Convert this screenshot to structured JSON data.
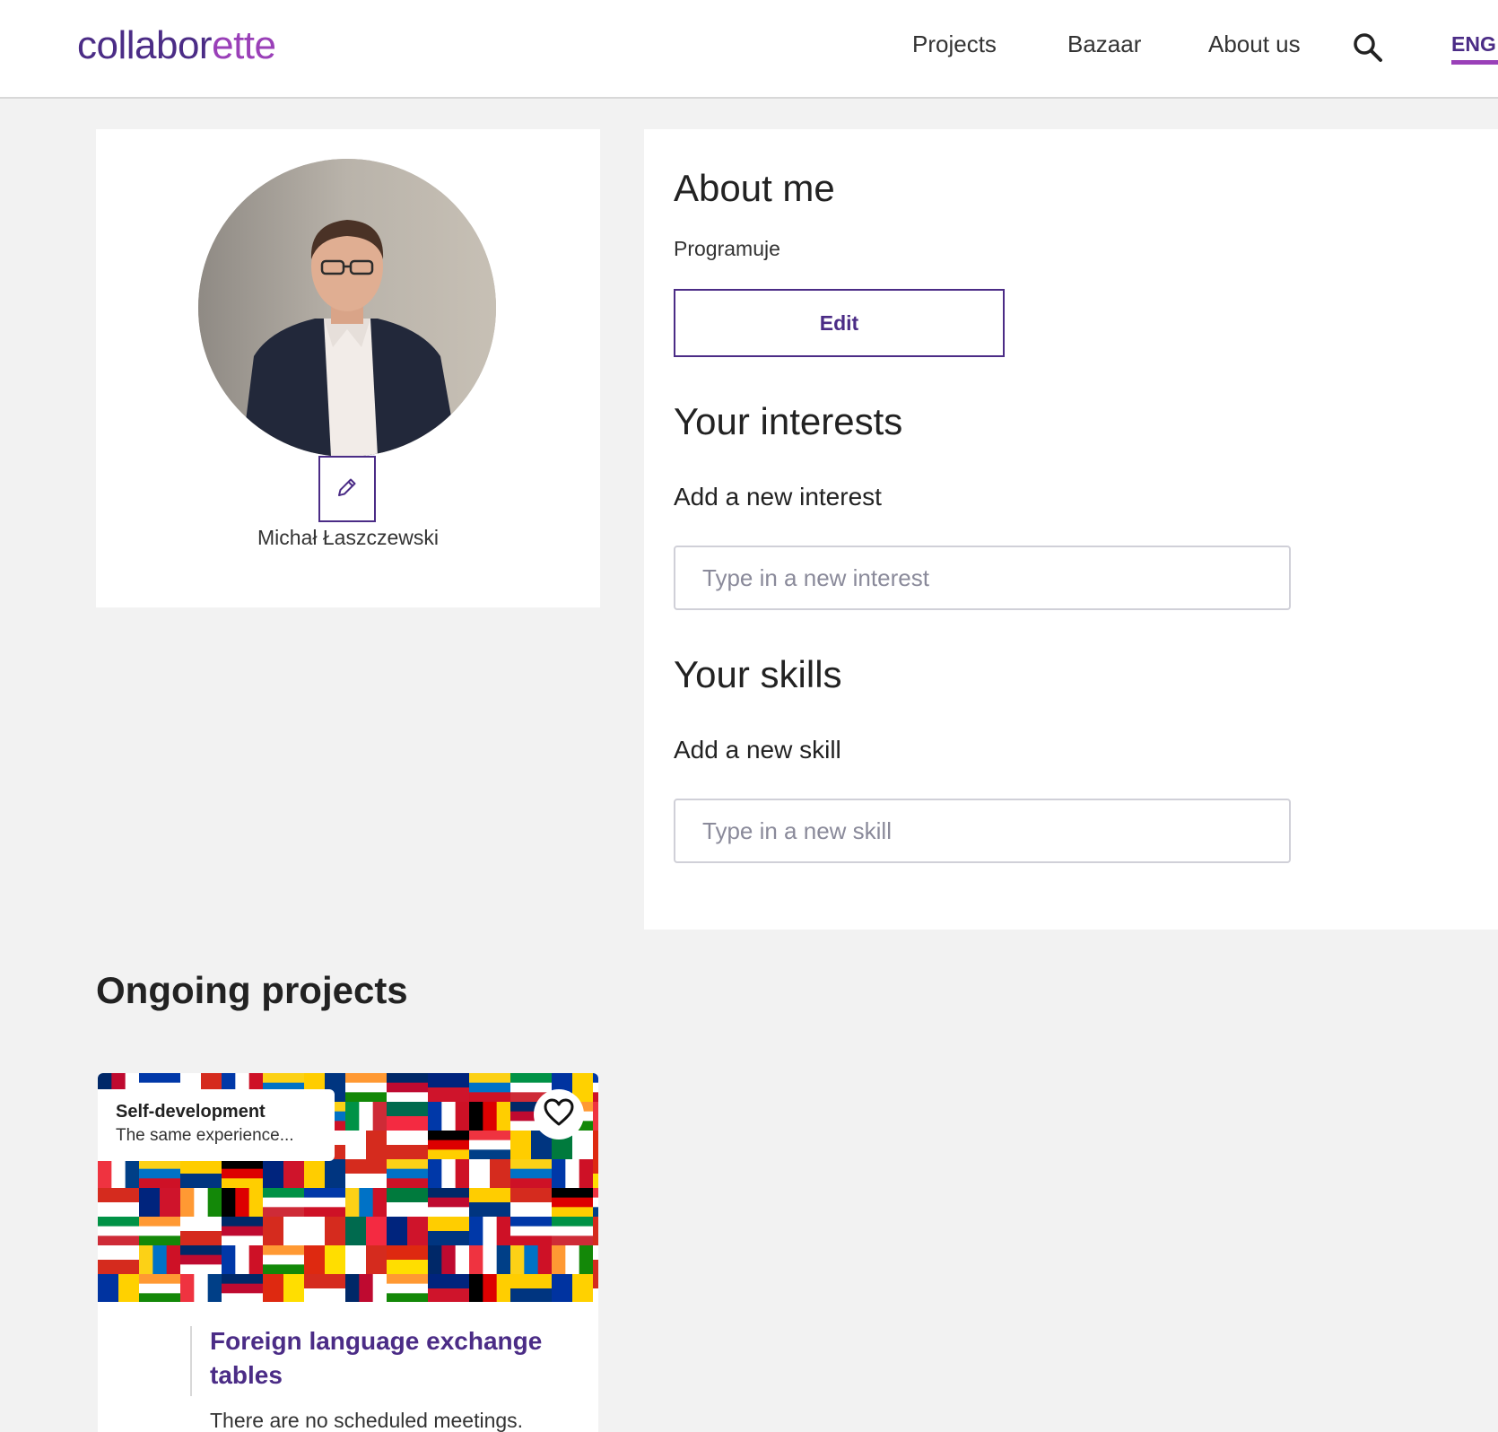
{
  "header": {
    "logo_main": "collabor",
    "logo_accent": "ette",
    "nav": [
      "Projects",
      "Bazaar",
      "About us"
    ],
    "language": "ENG"
  },
  "profile": {
    "name": "Michał Łaszczewski"
  },
  "about": {
    "title": "About me",
    "text": "Programuje",
    "edit_label": "Edit"
  },
  "interests": {
    "title": "Your interests",
    "label": "Add a new interest",
    "placeholder": "Type in a new interest",
    "value": ""
  },
  "skills": {
    "title": "Your skills",
    "label": "Add a new skill",
    "placeholder": "Type in a new skill",
    "value": ""
  },
  "projects": {
    "section_title": "Ongoing projects",
    "items": [
      {
        "category": "Self-development",
        "category_desc": "The same experience...",
        "title": "Foreign language exchange tables",
        "status": "There are no scheduled meetings."
      }
    ]
  },
  "colors": {
    "brand": "#4b2c86",
    "accent": "#9a40b8",
    "background": "#f2f2f2"
  }
}
